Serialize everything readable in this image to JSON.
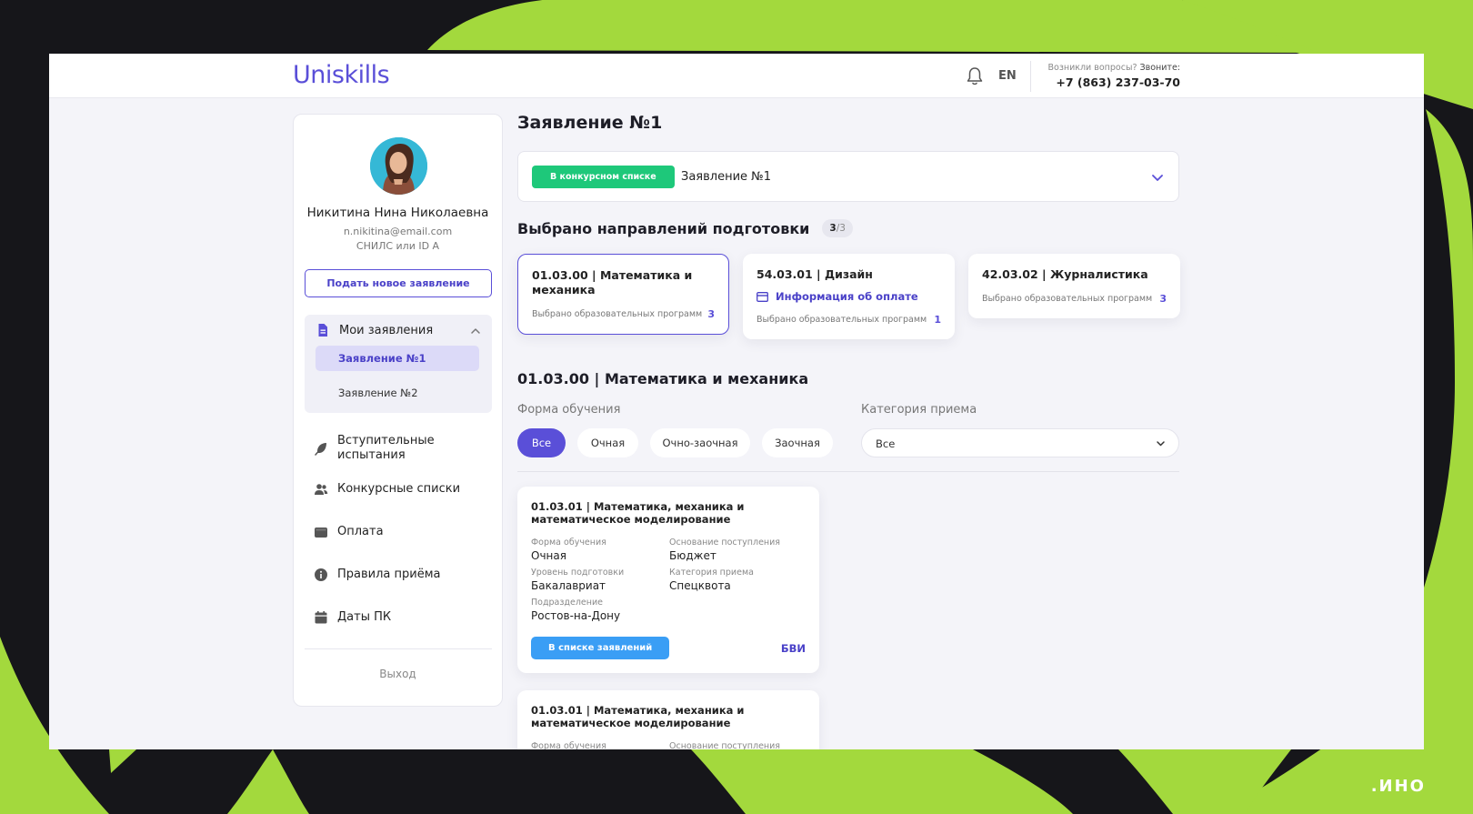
{
  "header": {
    "logo": "Uniskills",
    "lang": "EN",
    "contact_question": "Возникли вопросы?",
    "contact_call": "Звоните:",
    "phone": "+7 (863) 237-03-70"
  },
  "profile": {
    "name": "Никитина Нина Николаевна",
    "email": "n.nikitina@email.com",
    "snils": "СНИЛС или ID A",
    "new_app_label": "Подать новое заявление"
  },
  "sidebar": {
    "my_apps_label": "Мои заявления",
    "apps": [
      {
        "label": "Заявление №1",
        "active": true
      },
      {
        "label": "Заявление №2",
        "active": false
      }
    ],
    "items": [
      {
        "label": "Вступительные испытания",
        "icon": "feather-icon"
      },
      {
        "label": "Конкурсные списки",
        "icon": "users-icon"
      },
      {
        "label": "Оплата",
        "icon": "wallet-icon"
      },
      {
        "label": "Правила приёма",
        "icon": "info-icon"
      },
      {
        "label": "Даты ПК",
        "icon": "calendar-icon"
      }
    ],
    "logout_label": "Выход"
  },
  "main": {
    "title": "Заявление №1",
    "application_select": {
      "status": "В конкурсном списке",
      "value": "Заявление №1"
    },
    "directions_title": "Выбрано направлений подготовки",
    "directions_count": "3",
    "directions_total": "/3",
    "directions": [
      {
        "title": "01.03.00 | Математика и механика",
        "programs_label": "Выбрано образовательных программ",
        "programs_count": "3",
        "payment_label": "",
        "selected": true
      },
      {
        "title": "54.03.01 | Дизайн",
        "programs_label": "Выбрано образовательных программ",
        "programs_count": "1",
        "payment_label": "Информация об оплате",
        "selected": false
      },
      {
        "title": "42.03.02 | Журналистика",
        "programs_label": "Выбрано образовательных программ",
        "programs_count": "3",
        "payment_label": "",
        "selected": false
      }
    ],
    "section_title": "01.03.00 | Математика и механика",
    "study_form_label": "Форма обучения",
    "study_forms": [
      "Все",
      "Очная",
      "Очно-заочная",
      "Заочная"
    ],
    "active_study_form": "Все",
    "category_label": "Категория приема",
    "category_value": "Все",
    "programs": [
      {
        "title": "01.03.01 | Математика, механика и математическое моделирование",
        "fields": [
          {
            "key": "Форма обучения",
            "value": "Очная"
          },
          {
            "key": "Основание поступления",
            "value": "Бюджет"
          },
          {
            "key": "Уровень подготовки",
            "value": "Бакалавриат"
          },
          {
            "key": "Категория приема",
            "value": "Спецквота"
          },
          {
            "key": "Подразделение",
            "value": "Ростов-на-Дону"
          }
        ],
        "status": "В списке заявлений",
        "tag": "БВИ"
      },
      {
        "title": "01.03.01 | Математика, механика и математическое моделирование",
        "fields": [
          {
            "key": "Форма обучения",
            "value": ""
          },
          {
            "key": "Основание поступления",
            "value": ""
          }
        ]
      }
    ]
  },
  "brand_mark": ".ИНО",
  "colors": {
    "accent": "#5a4fd8",
    "status_green": "#1ec87a",
    "status_blue": "#3a9ef5",
    "lime": "#a3d93d",
    "dark": "#16161a"
  }
}
